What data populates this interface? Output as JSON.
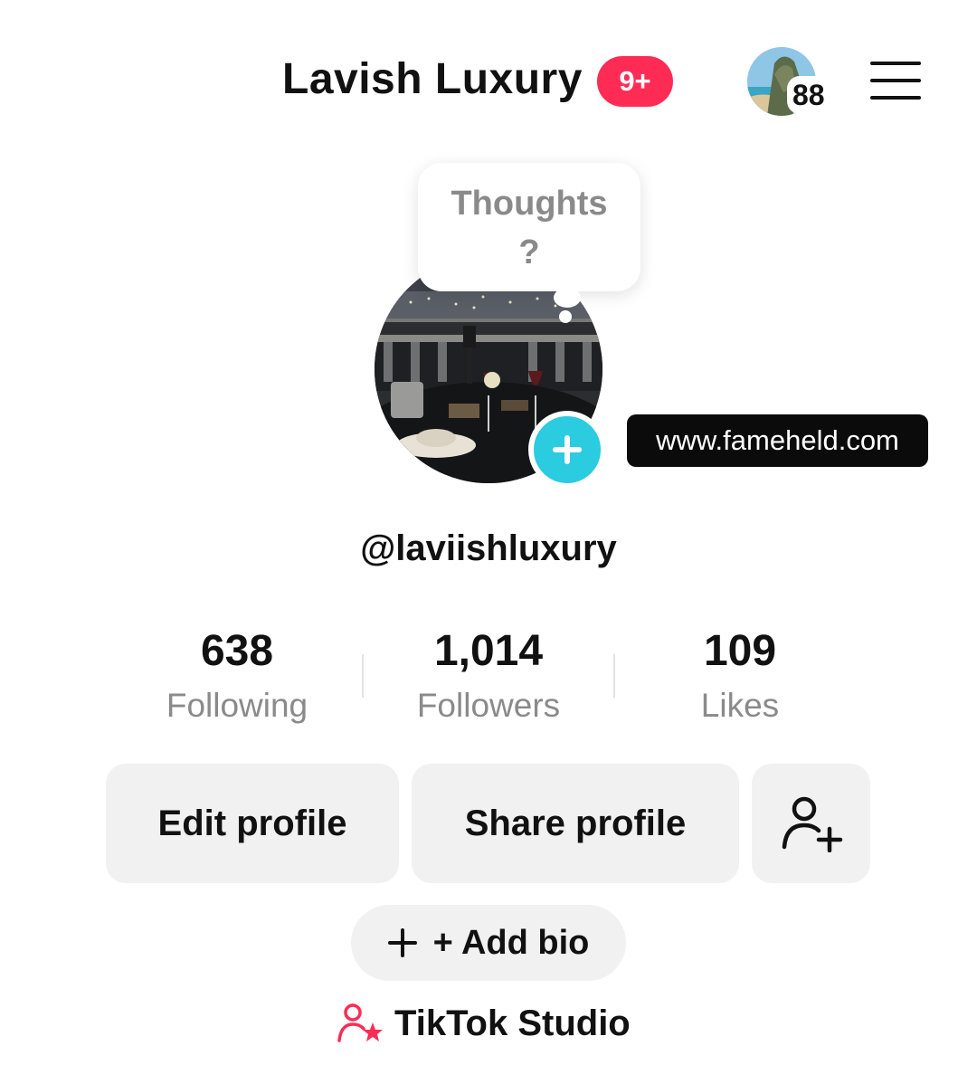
{
  "header": {
    "title": "Lavish Luxury",
    "notification_badge": "9+",
    "story_count": "88",
    "accent_color": "#fe2c55"
  },
  "profile": {
    "thought_bubble_line1": "Thoughts",
    "thought_bubble_line2": "?",
    "link": "www.fameheld.com",
    "username": "@laviishluxury"
  },
  "stats": [
    {
      "value": "638",
      "label": "Following"
    },
    {
      "value": "1,014",
      "label": "Followers"
    },
    {
      "value": "109",
      "label": "Likes"
    }
  ],
  "actions": {
    "edit_profile": "Edit profile",
    "share_profile": "Share profile",
    "add_bio": "+ Add bio",
    "studio": "TikTok Studio"
  },
  "icons": {
    "menu": "hamburger-menu-icon",
    "add_friend": "person-add-icon",
    "add_story": "plus-icon",
    "studio": "person-star-icon"
  },
  "colors": {
    "add_story": "#2bcbe0",
    "button_bg": "#f1f1f2"
  }
}
